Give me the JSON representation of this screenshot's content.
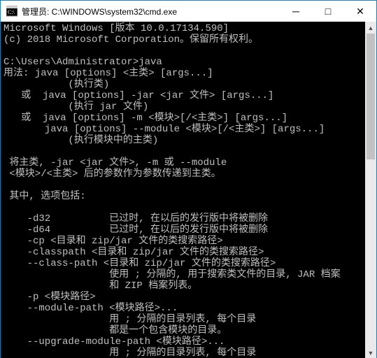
{
  "window": {
    "title": "管理员: C:\\WINDOWS\\system32\\cmd.exe"
  },
  "controls": {
    "minimize": "─",
    "maximize": "□",
    "close": "✕"
  },
  "scroll": {
    "up": "▲",
    "down": "▼"
  },
  "console_lines": [
    "Microsoft Windows [版本 10.0.17134.590]",
    "(c) 2018 Microsoft Corporation。保留所有权利。",
    "",
    "C:\\Users\\Administrator>java",
    "用法: java [options] <主类> [args...]",
    "           (执行类)",
    "   或  java [options] -jar <jar 文件> [args...]",
    "           (执行 jar 文件)",
    "   或  java [options] -m <模块>[/<主类>] [args...]",
    "       java [options] --module <模块>[/<主类>] [args...]",
    "           (执行模块中的主类)",
    "",
    " 将主类, -jar <jar 文件>, -m 或 --module",
    " <模块>/<主类> 后的参数作为参数传递到主类。",
    "",
    " 其中, 选项包括:",
    "",
    "    -d32          已过时, 在以后的发行版中将被删除",
    "    -d64          已过时, 在以后的发行版中将被删除",
    "    -cp <目录和 zip/jar 文件的类搜索路径>",
    "    -classpath <目录和 zip/jar 文件的类搜索路径>",
    "    --class-path <目录和 zip/jar 文件的类搜索路径>",
    "                  使用 ; 分隔的, 用于搜索类文件的目录, JAR 档案",
    "                  和 ZIP 档案列表。",
    "    -p <模块路径>",
    "    --module-path <模块路径>...",
    "                  用 ; 分隔的目录列表, 每个目录",
    "                  都是一个包含模块的目录。",
    "    --upgrade-module-path <模块路径>...",
    "                  用 ; 分隔的目录列表, 每个目录"
  ]
}
